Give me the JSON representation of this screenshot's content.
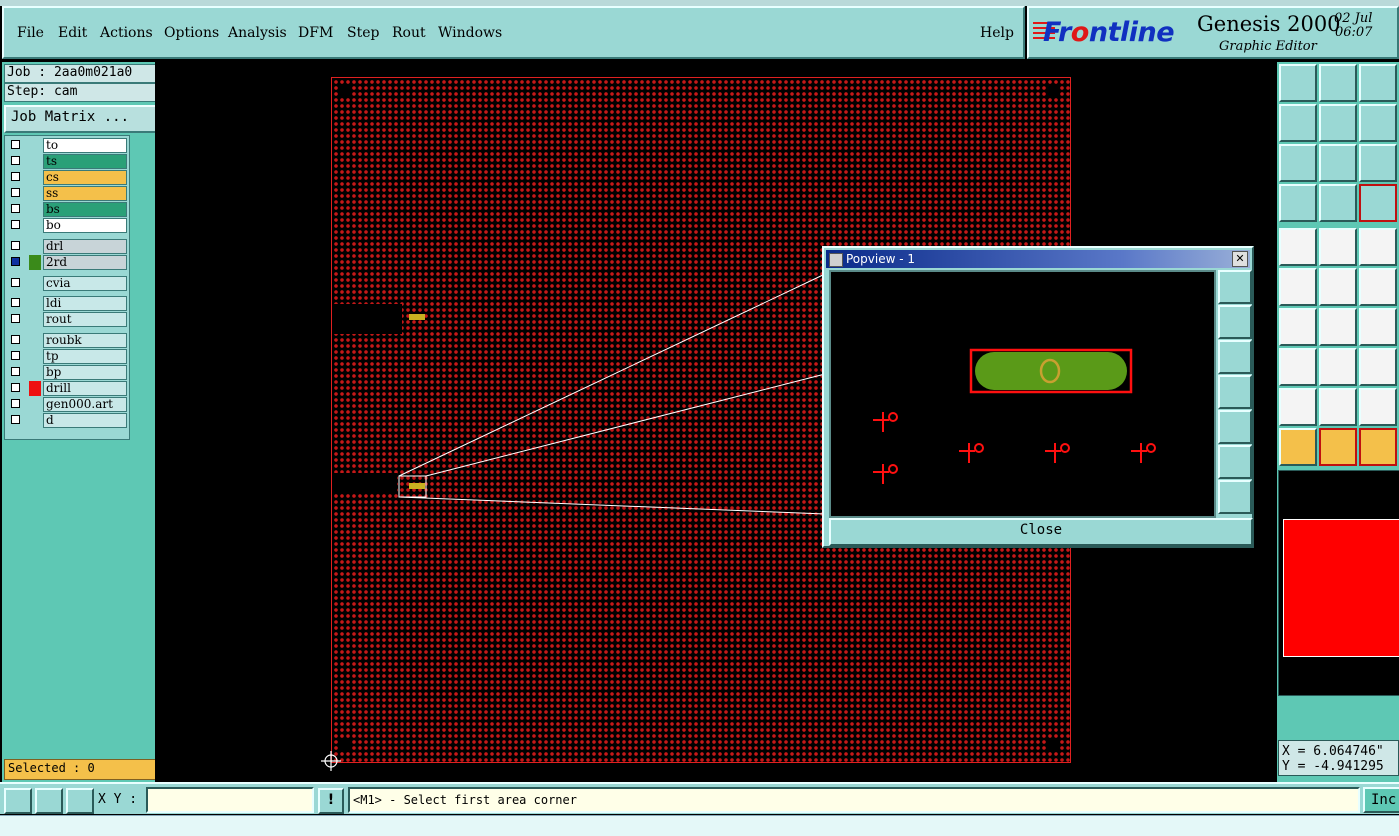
{
  "menu": {
    "file": "File",
    "edit": "Edit",
    "actions": "Actions",
    "options": "Options",
    "analysis": "Analysis",
    "dfm": "DFM",
    "step": "Step",
    "rout": "Rout",
    "windows": "Windows",
    "help": "Help"
  },
  "logo": {
    "brand_pre": "Fr",
    "brand_o": "o",
    "brand_post": "ntline",
    "product": "Genesis 2000",
    "subtitle": "Graphic Editor",
    "date": "02 Jul",
    "time": "06:07"
  },
  "left": {
    "job": "Job : 2aa0m021a0",
    "step": "Step: cam",
    "job_matrix": "Job Matrix ...",
    "layers": [
      {
        "name": "to",
        "color": "#ffffff"
      },
      {
        "name": "ts",
        "color": "#2aa078"
      },
      {
        "name": "cs",
        "color": "#f4c04a"
      },
      {
        "name": "ss",
        "color": "#f4c04a"
      },
      {
        "name": "bs",
        "color": "#2aa078"
      },
      {
        "name": "bo",
        "color": "#ffffff"
      },
      {
        "name": "drl",
        "color": "#c8d4d8"
      },
      {
        "name": "2rd",
        "color": "#c8d4d8"
      },
      {
        "name": "cvia",
        "color": "#c8e8e8"
      },
      {
        "name": "ldi",
        "color": "#c8e8e8"
      },
      {
        "name": "rout",
        "color": "#c8e8e8"
      },
      {
        "name": "roubk",
        "color": "#c8e8e8"
      },
      {
        "name": "tp",
        "color": "#c8e8e8"
      },
      {
        "name": "bp",
        "color": "#c8e8e8"
      },
      {
        "name": "drill",
        "color": "#c8e8e8"
      },
      {
        "name": "gen000.art",
        "color": "#c8e8e8"
      },
      {
        "name": "d",
        "color": "#c8e8e8"
      }
    ],
    "selected": "Selected : 0"
  },
  "popview": {
    "title": "Popview - 1",
    "close": "Close"
  },
  "coords": {
    "x": "X = 6.064746\"",
    "y": "Y = -4.941295"
  },
  "bottom": {
    "xy_label": "X Y :",
    "xy_value": "",
    "prompt": "<M1> - Select first area corner",
    "incr": "Inc"
  },
  "colors": {
    "panel": "#5ec8b4",
    "board": "#c41818",
    "pad_green": "#5a9a18"
  }
}
